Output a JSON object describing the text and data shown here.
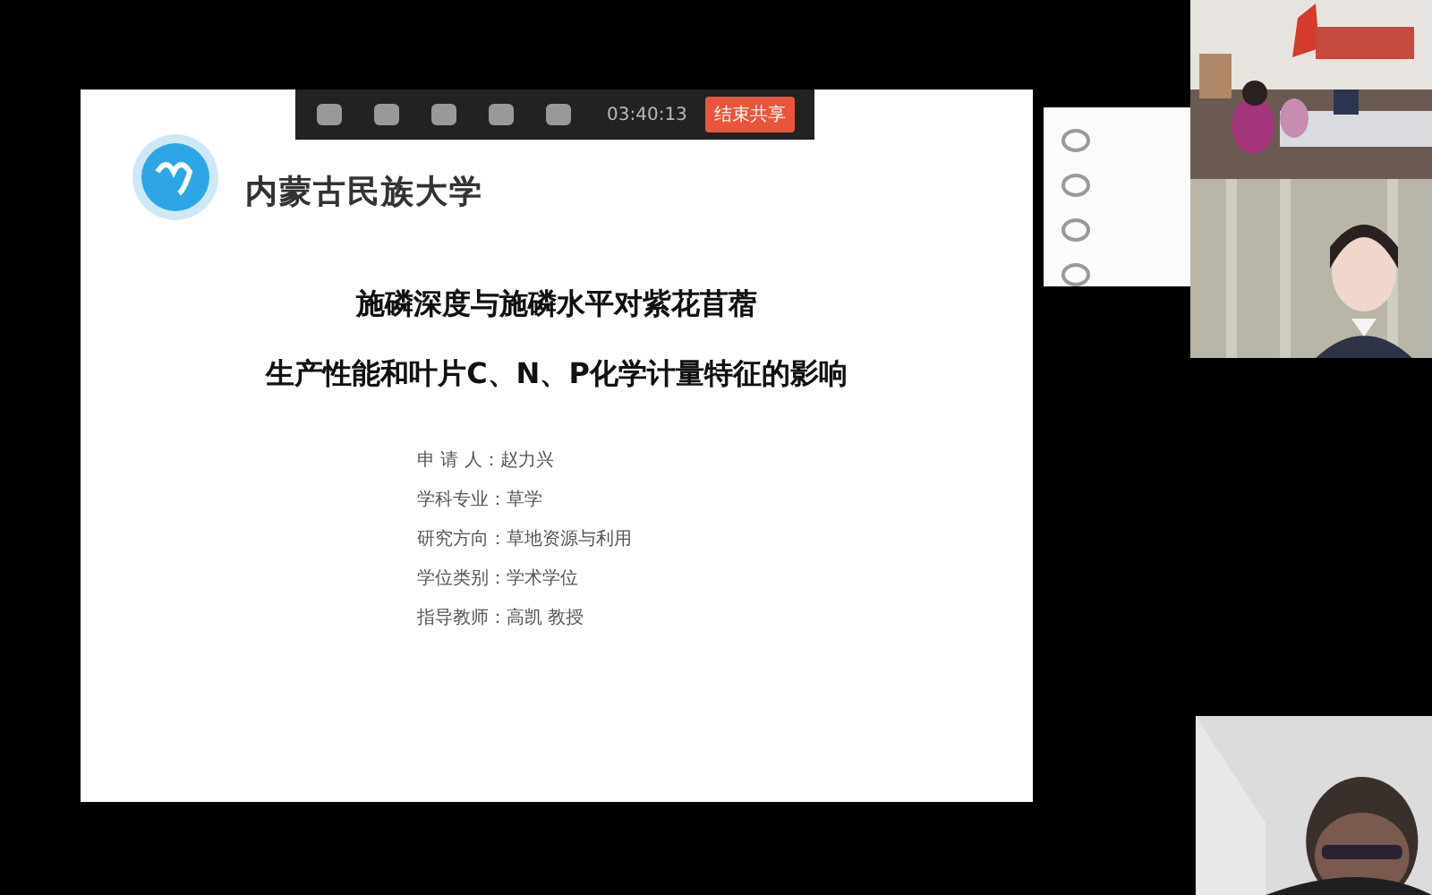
{
  "shared_slide": {
    "university_name": "内蒙古民族大学",
    "title_lines": [
      "施磷深度与施磷水平对紫花苜蓿",
      "生产性能和叶片C、N、P化学计量特征的影响"
    ],
    "details": [
      "申  请  人：赵力兴",
      "学科专业：草学",
      "研究方向：草地资源与利用",
      "学位类别：学术学位",
      "指导教师：高凯  教授"
    ]
  },
  "share_toolbar": {
    "timer": "03:40:13",
    "stop_button": "结束共享"
  }
}
